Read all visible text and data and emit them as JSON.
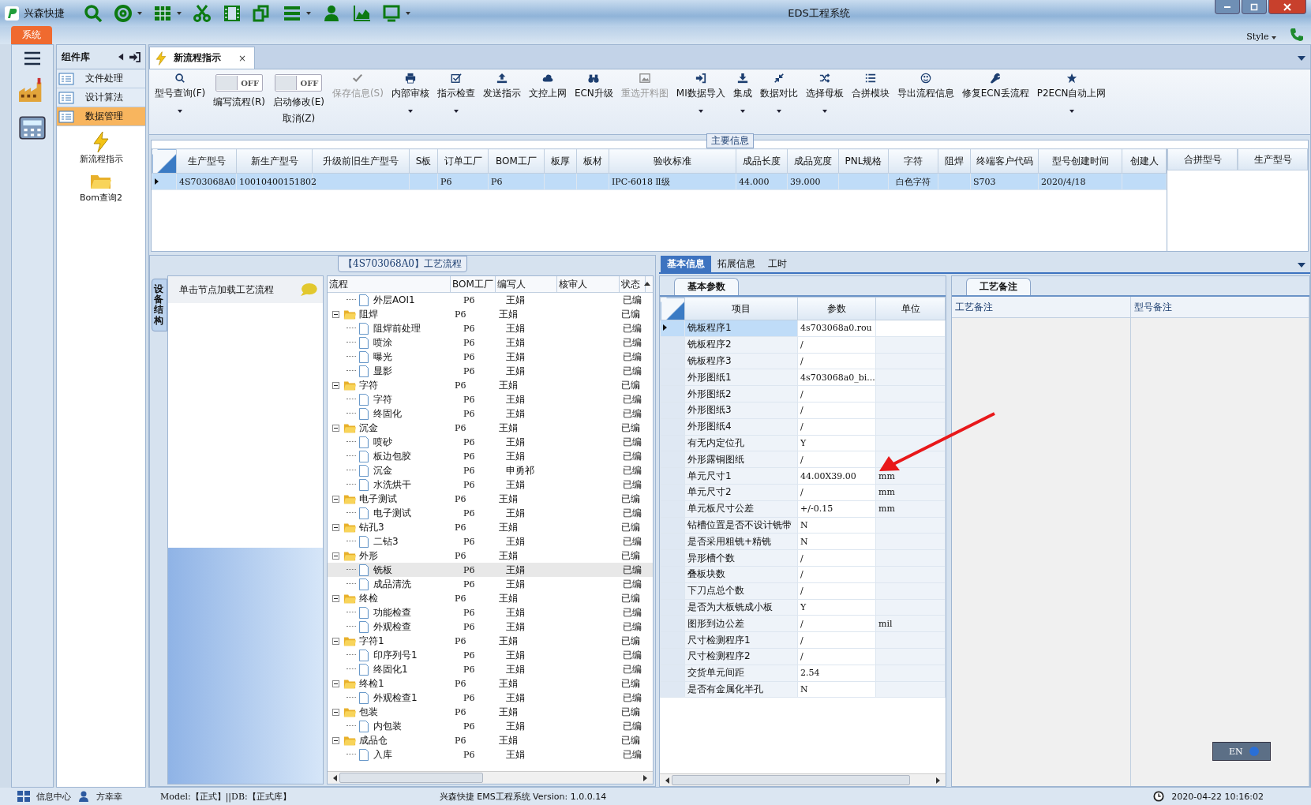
{
  "app": {
    "name": "兴森快捷",
    "title": "EDS工程系统"
  },
  "ribbon": {
    "tab": "系统",
    "style_menu": "Style"
  },
  "nav": {
    "header": "组件库",
    "items": [
      {
        "label": "文件处理",
        "selected": false
      },
      {
        "label": "设计算法",
        "selected": false
      },
      {
        "label": "数据管理",
        "selected": true
      }
    ],
    "tools": [
      {
        "label": "新流程指示",
        "kind": "lightning"
      },
      {
        "label": "Bom查询2",
        "kind": "folder"
      }
    ]
  },
  "doc_tab": {
    "label": "新流程指示",
    "close": "×"
  },
  "toolbar": [
    {
      "label": "型号查询(F)",
      "kind": "button",
      "dropdown": true,
      "disabled": false
    },
    {
      "label": "编写流程(R)",
      "kind": "toggle",
      "toggle_text": "OFF",
      "on": false
    },
    {
      "label": "启动修改(E)",
      "label_2": "取消(Z)",
      "kind": "toggle",
      "toggle_text": "OFF",
      "on": false
    },
    {
      "label": "保存信息(S)",
      "kind": "button",
      "dropdown": false,
      "disabled": true
    },
    {
      "label": "内部审核",
      "kind": "button",
      "dropdown": true,
      "disabled": false
    },
    {
      "label": "指示检查",
      "kind": "button",
      "dropdown": true,
      "disabled": false
    },
    {
      "label": "发送指示",
      "kind": "button",
      "dropdown": false,
      "disabled": false
    },
    {
      "label": "文控上网",
      "kind": "button",
      "dropdown": false,
      "disabled": false
    },
    {
      "label": "ECN升级",
      "kind": "button",
      "dropdown": false,
      "disabled": false
    },
    {
      "label": "重选开料图",
      "kind": "button",
      "dropdown": false,
      "disabled": true
    },
    {
      "label": "MI数据导入",
      "kind": "button",
      "dropdown": true,
      "disabled": false
    },
    {
      "label": "集成",
      "kind": "button",
      "dropdown": true,
      "disabled": false
    },
    {
      "label": "数据对比",
      "kind": "button",
      "dropdown": true,
      "disabled": false
    },
    {
      "label": "选择母板",
      "kind": "button",
      "dropdown": true,
      "disabled": false
    },
    {
      "label": "合拼模块",
      "kind": "button",
      "dropdown": false,
      "disabled": false
    },
    {
      "label": "导出流程信息",
      "kind": "button",
      "dropdown": false,
      "disabled": false
    },
    {
      "label": "修复ECN丢流程",
      "kind": "button",
      "dropdown": false,
      "disabled": false
    },
    {
      "label": "P2ECN自动上网",
      "kind": "button",
      "dropdown": true,
      "disabled": false
    }
  ],
  "main_info": {
    "title": "主要信息",
    "columns": [
      "生产型号",
      "新生产型号",
      "升级前旧生产型号",
      "S板",
      "订单工厂",
      "BOM工厂",
      "板厚",
      "板材",
      "验收标准",
      "成品长度",
      "成品宽度",
      "PNL规格",
      "字符",
      "阻焊",
      "终端客户代码",
      "型号创建时间",
      "创建人"
    ],
    "rows": [
      {
        "selected": true,
        "values": {
          "0": "4S703068A0",
          "1": "10010400151802",
          "4": "P6",
          "5": "P6",
          "8": "IPC-6018 Ⅱ级",
          "9": "44.000",
          "10": "39.000",
          "12": "白色字符",
          "14": "S703",
          "15": "2020/4/18"
        }
      }
    ],
    "side_columns": [
      "合拼型号",
      "生产型号"
    ]
  },
  "process": {
    "title": "【4S703068A0】工艺流程",
    "side_tab": "设备结构",
    "hint": "单击节点加载工艺流程",
    "columns": [
      "流程",
      "BOM工厂",
      "编写人",
      "核审人",
      "状态"
    ],
    "tree": [
      {
        "name": "外层AOI1",
        "kind": "file",
        "factory": "P6",
        "author": "王娟",
        "status": "已编",
        "selected": false
      },
      {
        "name": "阻焊",
        "kind": "folder",
        "expanded": true,
        "factory": "P6",
        "author": "王娟",
        "status": "已编",
        "selected": false,
        "children": [
          {
            "name": "阻焊前处理",
            "kind": "file",
            "factory": "P6",
            "author": "王娟",
            "status": "已编",
            "selected": false
          },
          {
            "name": "喷涂",
            "kind": "file",
            "factory": "P6",
            "author": "王娟",
            "status": "已编",
            "selected": false
          },
          {
            "name": "曝光",
            "kind": "file",
            "factory": "P6",
            "author": "王娟",
            "status": "已编",
            "selected": false
          },
          {
            "name": "显影",
            "kind": "file",
            "factory": "P6",
            "author": "王娟",
            "status": "已编",
            "selected": false
          }
        ]
      },
      {
        "name": "字符",
        "kind": "folder",
        "expanded": true,
        "factory": "P6",
        "author": "王娟",
        "status": "已编",
        "selected": false,
        "children": [
          {
            "name": "字符",
            "kind": "file",
            "factory": "P6",
            "author": "王娟",
            "status": "已编",
            "selected": false
          },
          {
            "name": "终固化",
            "kind": "file",
            "factory": "P6",
            "author": "王娟",
            "status": "已编",
            "selected": false
          }
        ]
      },
      {
        "name": "沉金",
        "kind": "folder",
        "expanded": true,
        "factory": "P6",
        "author": "王娟",
        "status": "已编",
        "selected": false,
        "children": [
          {
            "name": "喷砂",
            "kind": "file",
            "factory": "P6",
            "author": "王娟",
            "status": "已编",
            "selected": false
          },
          {
            "name": "板边包胶",
            "kind": "file",
            "factory": "P6",
            "author": "王娟",
            "status": "已编",
            "selected": false
          },
          {
            "name": "沉金",
            "kind": "file",
            "factory": "P6",
            "author": "申勇祁",
            "status": "已编",
            "selected": false
          },
          {
            "name": "水洗烘干",
            "kind": "file",
            "factory": "P6",
            "author": "王娟",
            "status": "已编",
            "selected": false
          }
        ]
      },
      {
        "name": "电子测试",
        "kind": "folder",
        "expanded": true,
        "factory": "P6",
        "author": "王娟",
        "status": "已编",
        "selected": false,
        "children": [
          {
            "name": "电子测试",
            "kind": "file",
            "factory": "P6",
            "author": "王娟",
            "status": "已编",
            "selected": false
          }
        ]
      },
      {
        "name": "钻孔3",
        "kind": "folder",
        "expanded": true,
        "factory": "P6",
        "author": "王娟",
        "status": "已编",
        "selected": false,
        "children": [
          {
            "name": "二钻3",
            "kind": "file",
            "factory": "P6",
            "author": "王娟",
            "status": "已编",
            "selected": false
          }
        ]
      },
      {
        "name": "外形",
        "kind": "folder",
        "expanded": true,
        "factory": "P6",
        "author": "王娟",
        "status": "已编",
        "selected": false,
        "children": [
          {
            "name": "铣板",
            "kind": "file",
            "factory": "P6",
            "author": "王娟",
            "status": "已编",
            "selected": true
          },
          {
            "name": "成品清洗",
            "kind": "file",
            "factory": "P6",
            "author": "王娟",
            "status": "已编",
            "selected": false
          }
        ]
      },
      {
        "name": "终检",
        "kind": "folder",
        "expanded": true,
        "factory": "P6",
        "author": "王娟",
        "status": "已编",
        "selected": false,
        "children": [
          {
            "name": "功能检查",
            "kind": "file",
            "factory": "P6",
            "author": "王娟",
            "status": "已编",
            "selected": false
          },
          {
            "name": "外观检查",
            "kind": "file",
            "factory": "P6",
            "author": "王娟",
            "status": "已编",
            "selected": false
          }
        ]
      },
      {
        "name": "字符1",
        "kind": "folder",
        "expanded": true,
        "factory": "P6",
        "author": "王娟",
        "status": "已编",
        "selected": false,
        "children": [
          {
            "name": "印序列号1",
            "kind": "file",
            "factory": "P6",
            "author": "王娟",
            "status": "已编",
            "selected": false
          },
          {
            "name": "终固化1",
            "kind": "file",
            "factory": "P6",
            "author": "王娟",
            "status": "已编",
            "selected": false
          }
        ]
      },
      {
        "name": "终检1",
        "kind": "folder",
        "expanded": true,
        "factory": "P6",
        "author": "王娟",
        "status": "已编",
        "selected": false,
        "children": [
          {
            "name": "外观检查1",
            "kind": "file",
            "factory": "P6",
            "author": "王娟",
            "status": "已编",
            "selected": false
          }
        ]
      },
      {
        "name": "包装",
        "kind": "folder",
        "expanded": true,
        "factory": "P6",
        "author": "王娟",
        "status": "已编",
        "selected": false,
        "children": [
          {
            "name": "内包装",
            "kind": "file",
            "factory": "P6",
            "author": "王娟",
            "status": "已编",
            "selected": false
          }
        ]
      },
      {
        "name": "成品仓",
        "kind": "folder",
        "expanded": true,
        "factory": "P6",
        "author": "王娟",
        "status": "已编",
        "selected": false,
        "children": [
          {
            "name": "入库",
            "kind": "file",
            "factory": "P6",
            "author": "王娟",
            "status": "已编",
            "selected": false
          }
        ]
      }
    ]
  },
  "details": {
    "tabs": [
      {
        "label": "基本信息",
        "selected": true
      },
      {
        "label": "拓展信息",
        "selected": false
      },
      {
        "label": "工时",
        "selected": false
      }
    ],
    "group": "基本参数",
    "columns": [
      "项目",
      "参数",
      "单位"
    ],
    "rows": [
      {
        "item": "铣板程序1",
        "value": "4s703068a0.rou",
        "selected": true
      },
      {
        "item": "铣板程序2",
        "value": "/",
        "selected": false
      },
      {
        "item": "铣板程序3",
        "value": "/",
        "selected": false
      },
      {
        "item": "外形图纸1",
        "value": "4s703068a0_bi...",
        "selected": false
      },
      {
        "item": "外形图纸2",
        "value": "/",
        "selected": false
      },
      {
        "item": "外形图纸3",
        "value": "/",
        "selected": false
      },
      {
        "item": "外形图纸4",
        "value": "/",
        "selected": false
      },
      {
        "item": "有无内定位孔",
        "value": "Y",
        "selected": false
      },
      {
        "item": "外形露铜图纸",
        "value": "/",
        "selected": false
      },
      {
        "item": "单元尺寸1",
        "value": "44.00X39.00",
        "unit": "mm",
        "selected": false
      },
      {
        "item": "单元尺寸2",
        "value": "/",
        "unit": "mm",
        "selected": false
      },
      {
        "item": "单元板尺寸公差",
        "value": "+/-0.15",
        "unit": "mm",
        "selected": false
      },
      {
        "item": "钻槽位置是否不设计铣带",
        "value": "N",
        "selected": false
      },
      {
        "item": "是否采用粗铣+精铣",
        "value": "N",
        "selected": false
      },
      {
        "item": "异形槽个数",
        "value": "/",
        "selected": false
      },
      {
        "item": "叠板块数",
        "value": "/",
        "selected": false
      },
      {
        "item": "下刀点总个数",
        "value": "/",
        "selected": false
      },
      {
        "item": "是否为大板铣成小板",
        "value": "Y",
        "selected": false
      },
      {
        "item": "图形到边公差",
        "value": "/",
        "unit": "mil",
        "selected": false
      },
      {
        "item": "尺寸检测程序1",
        "value": "/",
        "selected": false
      },
      {
        "item": "尺寸检测程序2",
        "value": "/",
        "selected": false
      },
      {
        "item": "交货单元间距",
        "value": "2.54",
        "selected": false
      },
      {
        "item": "是否有金属化半孔",
        "value": "N",
        "selected": false
      }
    ]
  },
  "notes": {
    "group": "工艺备注",
    "columns": [
      "工艺备注",
      "型号备注"
    ]
  },
  "lang_indicator": "EN",
  "status_bar": {
    "center": "信息中心",
    "user": "方幸幸",
    "model": "Model:【正式】||DB:【正式库】",
    "version": "兴森快捷 EMS工程系统 Version: 1.0.0.14",
    "time": "2020-04-22 10:16:02"
  }
}
